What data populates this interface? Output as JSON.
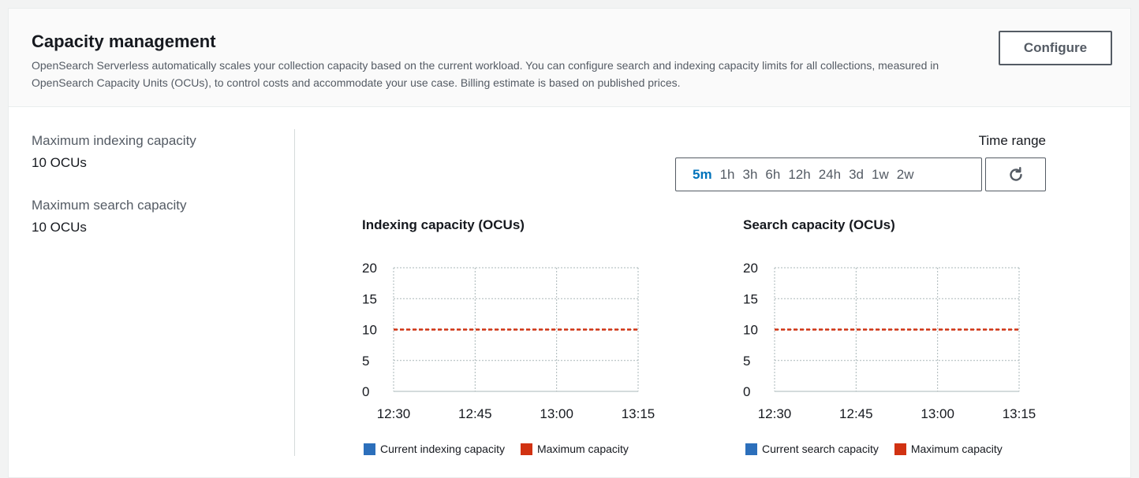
{
  "header": {
    "title": "Capacity management",
    "description": "OpenSearch Serverless automatically scales your collection capacity based on the current workload. You can configure search and indexing capacity limits for all collections, measured in OpenSearch Capacity Units (OCUs), to control costs and accommodate your use case. Billing estimate is based on published prices.",
    "configure_label": "Configure"
  },
  "settings": {
    "max_indexing_label": "Maximum indexing capacity",
    "max_indexing_value": "10 OCUs",
    "max_search_label": "Maximum search capacity",
    "max_search_value": "10 OCUs"
  },
  "time_range": {
    "label": "Time range",
    "options": [
      "5m",
      "1h",
      "3h",
      "6h",
      "12h",
      "24h",
      "3d",
      "1w",
      "2w"
    ],
    "selected": "5m",
    "refresh_icon": "refresh-icon"
  },
  "colors": {
    "current": "#2c6fbb",
    "maximum": "#d13212",
    "active_segment": "#0073bb"
  },
  "chart_data": [
    {
      "type": "line",
      "title": "Indexing capacity (OCUs)",
      "x": [
        "12:30",
        "12:45",
        "13:00",
        "13:15"
      ],
      "ylim": [
        0,
        20
      ],
      "yticks": [
        0,
        5,
        10,
        15,
        20
      ],
      "series": [
        {
          "name": "Current indexing capacity",
          "values": []
        },
        {
          "name": "Maximum capacity",
          "values": [
            10,
            10,
            10,
            10
          ],
          "style": "dashed"
        }
      ],
      "grid": true,
      "legend": "bottom"
    },
    {
      "type": "line",
      "title": "Search capacity (OCUs)",
      "x": [
        "12:30",
        "12:45",
        "13:00",
        "13:15"
      ],
      "ylim": [
        0,
        20
      ],
      "yticks": [
        0,
        5,
        10,
        15,
        20
      ],
      "series": [
        {
          "name": "Current search capacity",
          "values": []
        },
        {
          "name": "Maximum capacity",
          "values": [
            10,
            10,
            10,
            10
          ],
          "style": "dashed"
        }
      ],
      "grid": true,
      "legend": "bottom"
    }
  ]
}
